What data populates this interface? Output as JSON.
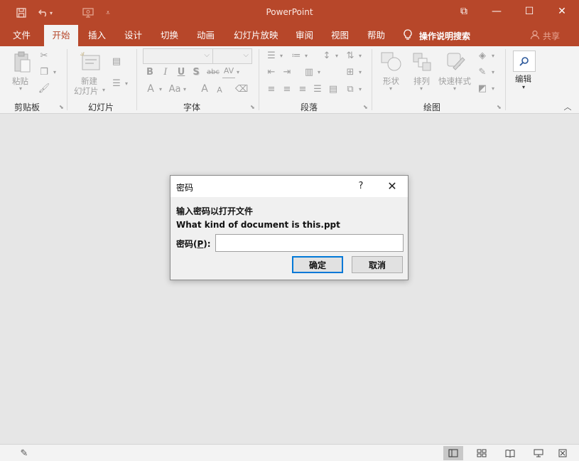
{
  "app": {
    "title": "PowerPoint",
    "accent_color": "#b7472a"
  },
  "quick_access": {
    "save_icon": "save-icon",
    "undo_icon": "undo-icon",
    "present_icon": "start-from-beginning-icon",
    "customize_icon": "customize-qat-icon"
  },
  "window": {
    "restore_glyph": "⧉",
    "minimize_glyph": "—",
    "maximize_glyph": "☐",
    "close_glyph": "✕"
  },
  "ribbon_tabs": [
    {
      "label": "文件",
      "active": false
    },
    {
      "label": "开始",
      "active": true
    },
    {
      "label": "插入",
      "active": false
    },
    {
      "label": "设计",
      "active": false
    },
    {
      "label": "切换",
      "active": false
    },
    {
      "label": "动画",
      "active": false
    },
    {
      "label": "幻灯片放映",
      "active": false
    },
    {
      "label": "审阅",
      "active": false
    },
    {
      "label": "视图",
      "active": false
    },
    {
      "label": "帮助",
      "active": false
    }
  ],
  "tell_me": {
    "label": "操作说明搜索"
  },
  "share": {
    "label": "共享"
  },
  "ribbon": {
    "clipboard": {
      "group_label": "剪贴板",
      "paste_label": "粘贴"
    },
    "slides": {
      "group_label": "幻灯片",
      "new_slide_line1": "新建",
      "new_slide_line2": "幻灯片"
    },
    "font": {
      "group_label": "字体",
      "bold": "B",
      "italic": "I",
      "underline": "U",
      "shadow": "S",
      "strike": "abc",
      "spacing": "AV",
      "font_color": "A",
      "change_case": "Aa",
      "grow": "A",
      "shrink": "A"
    },
    "paragraph": {
      "group_label": "段落"
    },
    "drawing": {
      "group_label": "绘图",
      "shapes_label": "形状",
      "arrange_label": "排列",
      "quick_styles_label": "快速样式"
    },
    "editing": {
      "label": "编辑"
    }
  },
  "dialog": {
    "title": "密码",
    "help": "?",
    "close": "✕",
    "line1": "输入密码以打开文件",
    "line2": "What kind of document is this.ppt",
    "password_label_prefix": "密码(",
    "password_label_key": "P",
    "password_label_suffix": "):",
    "password_value": "",
    "ok_label": "确定",
    "cancel_label": "取消"
  },
  "statusbar": {
    "notes_icon": "notes-icon",
    "views": [
      "normal-view-icon",
      "slide-sorter-icon",
      "reading-view-icon",
      "slideshow-icon",
      "fit-to-window-icon"
    ]
  }
}
